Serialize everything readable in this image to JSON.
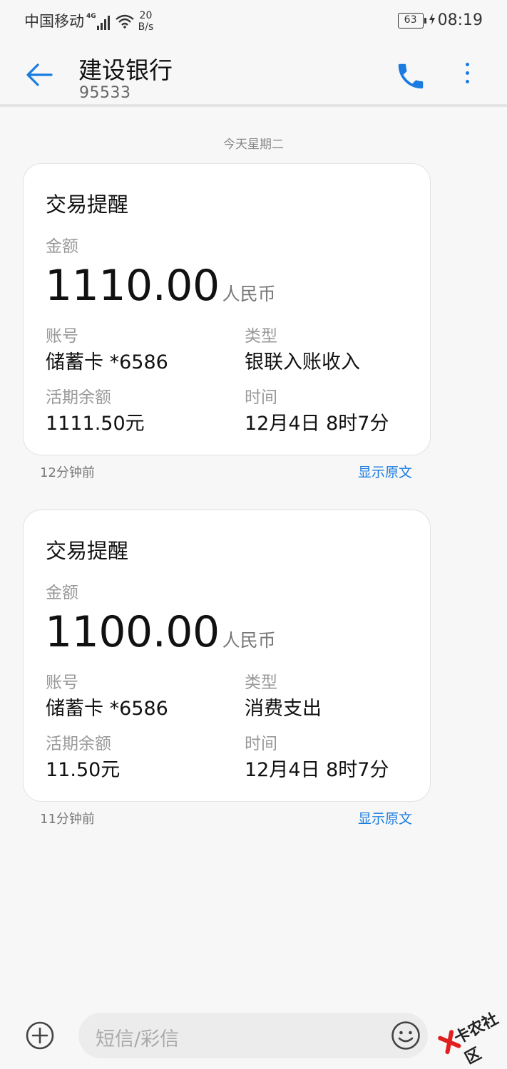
{
  "status_bar": {
    "carrier": "中国移动",
    "network": "4G",
    "speed_value": "20",
    "speed_unit": "B/s",
    "battery": "63",
    "time": "08:19"
  },
  "header": {
    "title": "建设银行",
    "subtitle": "95533"
  },
  "date_separator": "今天星期二",
  "messages": [
    {
      "title": "交易提醒",
      "amount_label": "金额",
      "amount": "1110.00",
      "currency": "人民币",
      "account_label": "账号",
      "account_value": "储蓄卡 *6586",
      "type_label": "类型",
      "type_value": "银联入账收入",
      "balance_label": "活期余额",
      "balance_value": "1111.50元",
      "time_label": "时间",
      "time_value": "12月4日 8时7分",
      "relative_time": "12分钟前",
      "show_original": "显示原文"
    },
    {
      "title": "交易提醒",
      "amount_label": "金额",
      "amount": "1100.00",
      "currency": "人民币",
      "account_label": "账号",
      "account_value": "储蓄卡 *6586",
      "type_label": "类型",
      "type_value": "消费支出",
      "balance_label": "活期余额",
      "balance_value": "11.50元",
      "time_label": "时间",
      "time_value": "12月4日 8时7分",
      "relative_time": "11分钟前",
      "show_original": "显示原文"
    }
  ],
  "composer": {
    "placeholder": "短信/彩信"
  },
  "watermark": "卡农社区",
  "colors": {
    "accent": "#1a7ce0",
    "background": "#f7f7f7"
  },
  "icons": {
    "back": "arrow-left-icon",
    "call": "phone-icon",
    "more": "more-vertical-icon",
    "add": "plus-circle-icon",
    "emoji": "smiley-icon"
  }
}
